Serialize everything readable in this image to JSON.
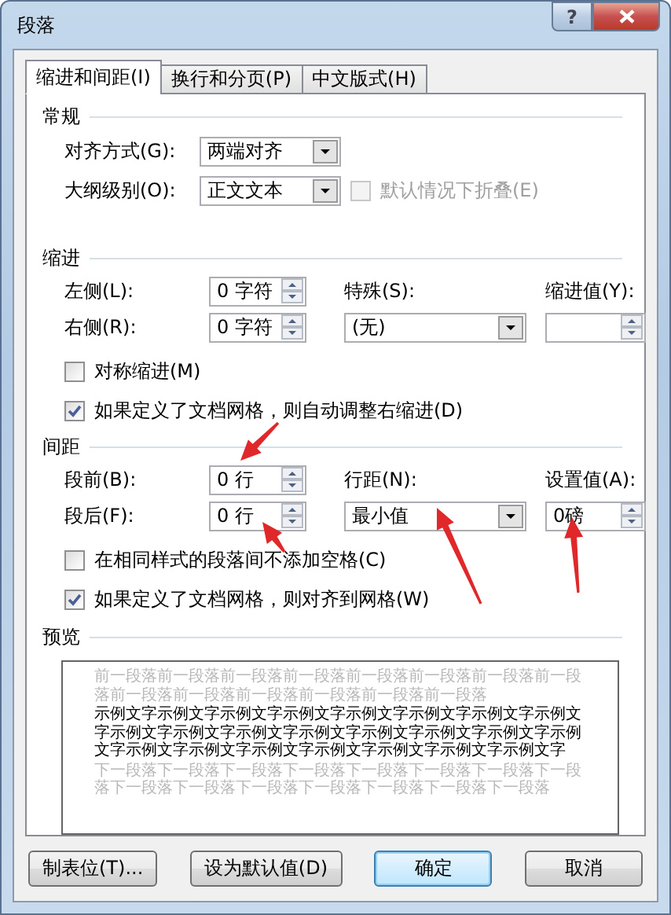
{
  "window": {
    "title": "段落",
    "help": "?"
  },
  "tabs": [
    {
      "label": "缩进和间距(I)",
      "selected": true
    },
    {
      "label": "换行和分页(P)",
      "selected": false
    },
    {
      "label": "中文版式(H)",
      "selected": false
    }
  ],
  "general": {
    "title": "常规",
    "alignment": {
      "label": "对齐方式(G):",
      "value": "两端对齐"
    },
    "outline_level": {
      "label": "大纲级别(O):",
      "value": "正文文本"
    },
    "collapse": {
      "label": "默认情况下折叠(E)",
      "checked": false,
      "disabled": true
    }
  },
  "indent": {
    "title": "缩进",
    "left": {
      "label": "左侧(L):",
      "value": "0 字符"
    },
    "right": {
      "label": "右侧(R):",
      "value": "0 字符"
    },
    "special": {
      "label": "特殊(S):",
      "value": "(无)"
    },
    "by": {
      "label": "缩进值(Y):"
    },
    "checks": [
      {
        "label": "对称缩进(M)",
        "checked": false,
        "disabled": false
      },
      {
        "label": "如果定义了文档网格，则自动调整右缩进(D)",
        "checked": true,
        "disabled": false
      }
    ]
  },
  "spacing": {
    "title": "间距",
    "before": {
      "label": "段前(B):",
      "value": "0 行"
    },
    "after": {
      "label": "段后(F):",
      "value": "0 行"
    },
    "line": {
      "label": "行距(N):",
      "value": "最小值"
    },
    "at": {
      "label": "设置值(A):",
      "value": "0磅"
    },
    "checks": [
      {
        "label": "在相同样式的段落间不添加空格(C)",
        "checked": false,
        "disabled": false
      },
      {
        "label": "如果定义了文档网格，则对齐到网格(W)",
        "checked": true,
        "disabled": false
      }
    ]
  },
  "preview": {
    "title": "预览",
    "previous": "前一段落前一段落前一段落前一段落前一段落前一段落前一段落前一段落前一段落前一段落前一段落前一段落前一段落前一段落",
    "sample": "示例文字示例文字示例文字示例文字示例文字示例文字示例文字示例文字示例文字示例文字示例文字示例文字示例文字示例文字示例文字示例文字示例文字示例文字示例文字示例文字示例文字示例文字示例文字",
    "next": "下一段落下一段落下一段落下一段落下一段落下一段落下一段落下一段落下一段落下一段落下一段落下一段落下一段落下一段落下一段落"
  },
  "buttons": [
    {
      "label": "制表位(T)...",
      "default": false
    },
    {
      "label": "设为默认值(D)",
      "default": false
    },
    {
      "label": "确定",
      "default": true
    },
    {
      "label": "取消",
      "default": false
    }
  ]
}
